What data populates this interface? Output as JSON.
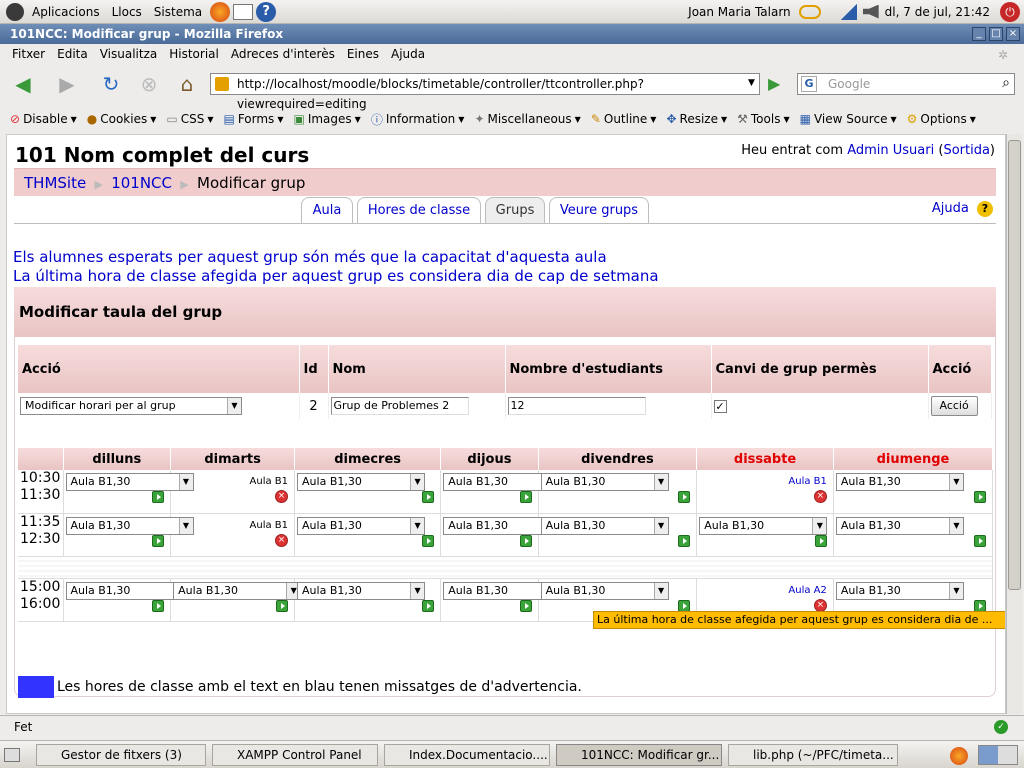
{
  "gnome_panel": {
    "apps": "Aplicacions",
    "places": "Llocs",
    "system": "Sistema",
    "user": "Joan Maria Talarn",
    "clock": "dl,  7 de jul, 21:42"
  },
  "window": {
    "title": "101NCC: Modificar grup - Mozilla Firefox"
  },
  "menubar": [
    "Fitxer",
    "Edita",
    "Visualitza",
    "Historial",
    "Adreces d'interès",
    "Eines",
    "Ajuda"
  ],
  "nav": {
    "url": "http://localhost/moodle/blocks/timetable/controller/ttcontroller.php?viewrequired=editing",
    "search_placeholder": "Google"
  },
  "webdev": [
    "Disable",
    "Cookies",
    "CSS",
    "Forms",
    "Images",
    "Information",
    "Miscellaneous",
    "Outline",
    "Resize",
    "Tools",
    "View Source",
    "Options"
  ],
  "page": {
    "course_title": "101 Nom complet del curs",
    "login_prefix": "Heu entrat com",
    "login_user": "Admin Usuari",
    "logout": "Sortida",
    "breadcrumb": [
      "THMSite",
      "101NCC",
      "Modificar grup"
    ],
    "tabs": [
      "Aula",
      "Hores de classe",
      "Grups",
      "Veure grups"
    ],
    "help": "Ajuda",
    "warnings": [
      "Els alumnes esperats per aquest grup són més que la capacitat d'aquesta aula",
      "La última hora de classe afegida per aquest grup es considera dia de cap de setmana"
    ],
    "box_title": "Modificar taula del grup",
    "group_table": {
      "headers": [
        "Acció",
        "Id",
        "Nom",
        "Nombre d'estudiants",
        "Canvi de grup permès",
        "Acció"
      ],
      "action_select": "Modificar horari per al grup",
      "id": "2",
      "name": "Grup de Problemes 2",
      "students": "12",
      "button": "Acció"
    },
    "days": [
      "dilluns",
      "dimarts",
      "dimecres",
      "dijous",
      "divendres",
      "dissabte",
      "diumenge"
    ],
    "slots": [
      {
        "start": "10:30",
        "end": "11:30",
        "cells": [
          "Aula B1,30",
          "Aula B1",
          "Aula B1,30",
          "Aula B1,30",
          "Aula B1,30",
          "Aula B1",
          "Aula B1,30"
        ]
      },
      {
        "start": "11:35",
        "end": "12:30",
        "cells": [
          "Aula B1,30",
          "Aula B1",
          "Aula B1,30",
          "Aula B1,30",
          "Aula B1,30",
          "Aula B1,30",
          "Aula B1,30"
        ]
      },
      {
        "start": "15:00",
        "end": "16:00",
        "cells": [
          "Aula B1,30",
          "Aula B1,30",
          "Aula B1,30",
          "Aula B1,30",
          "Aula B1,30",
          "Aula A2",
          "Aula B1,30"
        ]
      }
    ],
    "tooltip": "La última hora de classe afegida per aquest grup es considera dia de ...",
    "legend": "Les hores de classe amb el text en blau tenen missatges de d'advertencia."
  },
  "status": "Fet",
  "taskbar": [
    "Gestor de fitxers (3)",
    "XAMPP Control Panel",
    "Index.Documentacio....",
    "101NCC: Modificar gr...",
    "lib.php (~/PFC/timeta..."
  ],
  "colors": {
    "accent": "#0000cc",
    "header_pink": "#f0cccc",
    "weekend": "#e00000",
    "legend_blue": "#3333ff"
  }
}
